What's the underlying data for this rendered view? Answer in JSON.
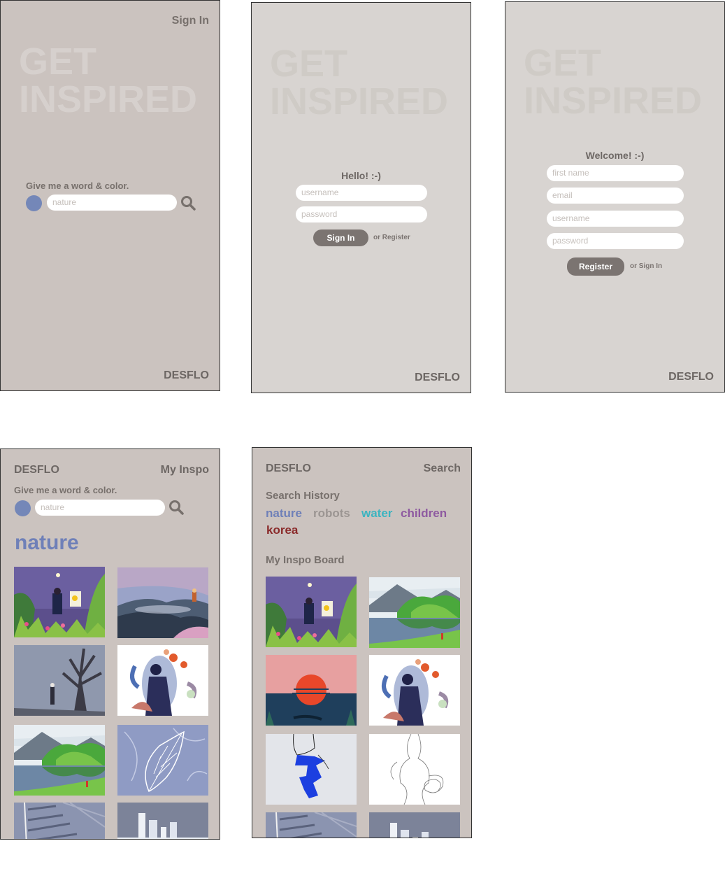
{
  "landing": {
    "signin_link": "Sign In",
    "hero_line1": "GET",
    "hero_line2": "INSPIRED",
    "prompt": "Give me a word & color.",
    "search_placeholder": "nature",
    "brand": "DESFLO",
    "color_swatch": "#7487b8"
  },
  "signin": {
    "hero_line1": "GET",
    "hero_line2": "INSPIRED",
    "title": "Hello! :-)",
    "username_placeholder": "username",
    "password_placeholder": "password",
    "submit_label": "Sign In",
    "alt_link": "or Register",
    "brand": "DESFLO"
  },
  "register": {
    "hero_line1": "GET",
    "hero_line2": "INSPIRED",
    "title": "Welcome! :-)",
    "firstname_placeholder": "first name",
    "email_placeholder": "email",
    "username_placeholder": "username",
    "password_placeholder": "password",
    "submit_label": "Register",
    "alt_link": "or Sign In",
    "brand": "DESFLO"
  },
  "results": {
    "brand": "DESFLO",
    "nav_right": "My Inspo",
    "prompt": "Give me a word & color.",
    "search_placeholder": "nature",
    "query_word": "nature",
    "color_swatch": "#7487b8",
    "images": [
      "painter-in-jungle",
      "woman-on-mountain",
      "girl-under-tree",
      "woman-with-flowers",
      "lake-forest",
      "leaf-pattern",
      "fern-leaves",
      "city-skyline"
    ]
  },
  "board": {
    "brand": "DESFLO",
    "nav_right": "Search",
    "history_heading": "Search History",
    "history_tags": [
      {
        "label": "nature",
        "color": "#6f80b8"
      },
      {
        "label": "robots",
        "color": "#9b9592"
      },
      {
        "label": "water",
        "color": "#3cb4c0"
      },
      {
        "label": "children",
        "color": "#8e5aa0"
      },
      {
        "label": "korea",
        "color": "#8a2a2a"
      }
    ],
    "board_heading": "My Inspo Board",
    "images": [
      "painter-in-jungle",
      "lake-forest",
      "sunset-sea",
      "woman-with-flowers",
      "blue-paint-figure",
      "line-drawing",
      "fern-leaves",
      "city-skyline"
    ]
  }
}
